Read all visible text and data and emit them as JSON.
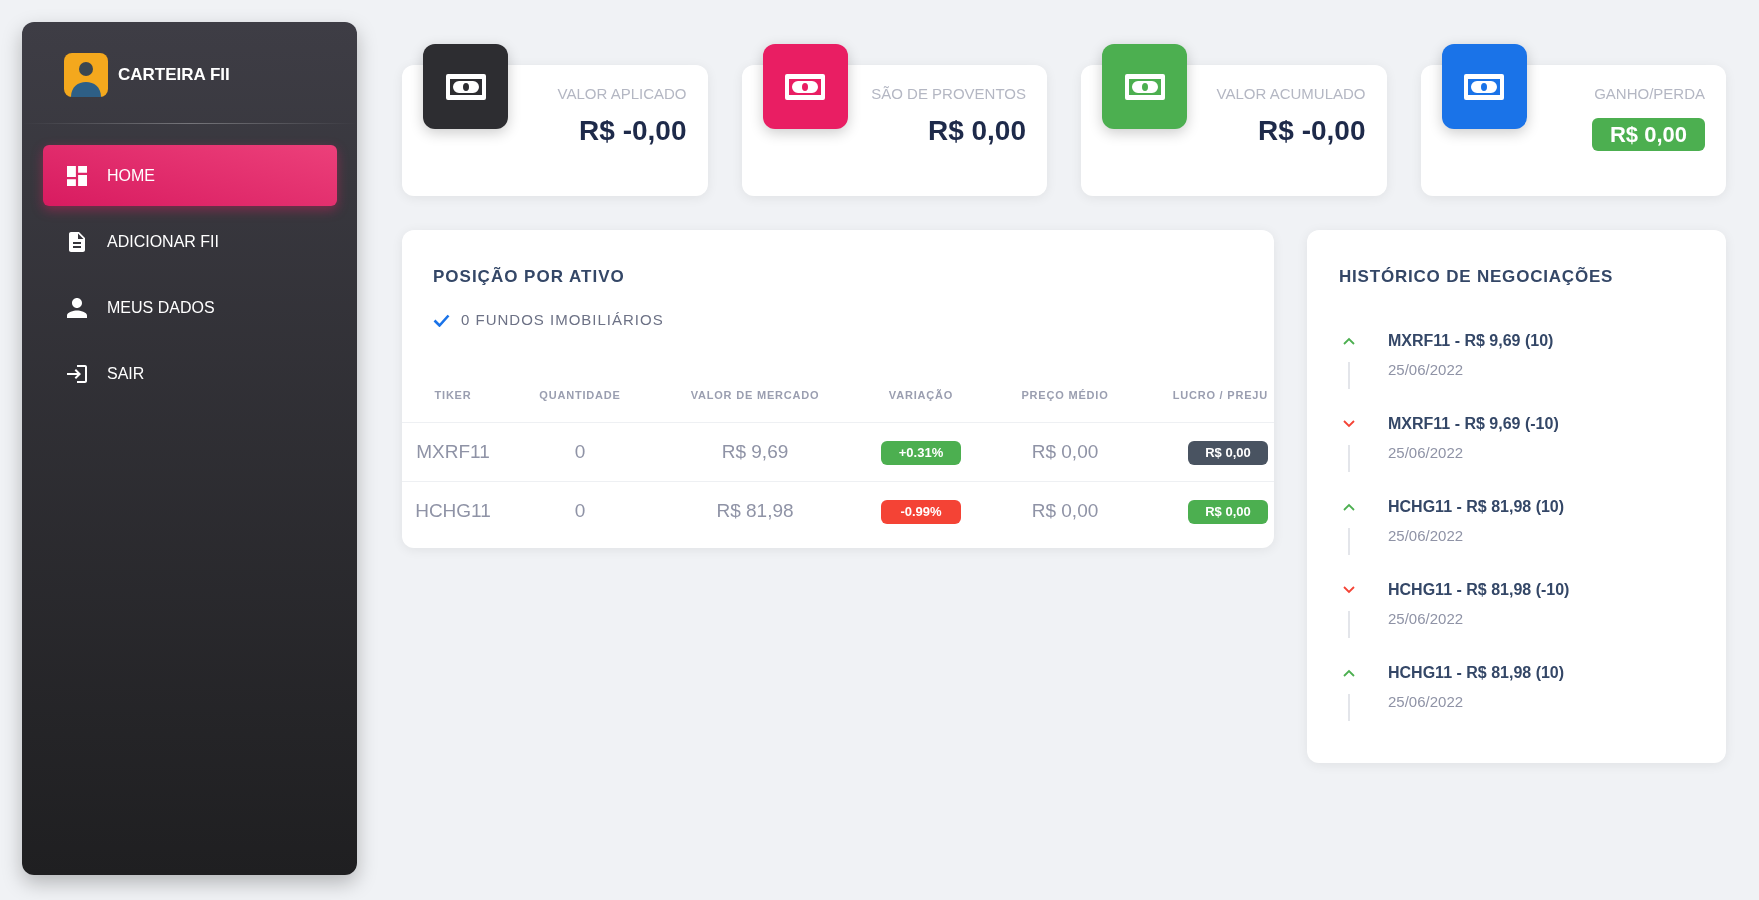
{
  "sidebar": {
    "brand": "CARTEIRA FII",
    "items": [
      {
        "label": "HOME",
        "selected": true
      },
      {
        "label": "ADICIONAR FII",
        "selected": false
      },
      {
        "label": "MEUS DADOS",
        "selected": false
      },
      {
        "label": "SAIR",
        "selected": false
      }
    ]
  },
  "stats": [
    {
      "kind": "plain",
      "label": "VALOR APLICADO",
      "value": "R$ -0,00",
      "color": "#2d2d31"
    },
    {
      "kind": "plain",
      "label": "SÃO DE PROVENTOS",
      "value": "R$ 0,00",
      "color": "#e91e63"
    },
    {
      "kind": "plain",
      "label": "VALOR ACUMULADO",
      "value": "R$ -0,00",
      "color": "#4caf50"
    },
    {
      "kind": "badge",
      "label": "GANHO/PERDA",
      "badge": {
        "text": "R$ 0,00",
        "color": "#4caf50"
      },
      "color": "#1a73e8"
    }
  ],
  "positions": {
    "title": "POSIÇÃO POR ATIVO",
    "summary": "0 FUNDOS IMOBILIÁRIOS",
    "table": {
      "columns": [
        "TIKER",
        "QUANTIDADE",
        "VALOR DE MERCADO",
        "VARIAÇÃO",
        "PREÇO MÉDIO",
        "LUCRO / PREJU"
      ],
      "rows": [
        {
          "cells": [
            {
              "kind": "text",
              "text": "MXRF11"
            },
            {
              "kind": "text",
              "text": "0"
            },
            {
              "kind": "text",
              "text": "R$ 9,69"
            },
            {
              "kind": "badge",
              "text": "+0.31%",
              "color": "#4caf50"
            },
            {
              "kind": "text",
              "text": "R$ 0,00"
            },
            {
              "kind": "badge",
              "text": "R$ 0,00",
              "color": "#495361"
            }
          ]
        },
        {
          "cells": [
            {
              "kind": "text",
              "text": "HCHG11"
            },
            {
              "kind": "text",
              "text": "0"
            },
            {
              "kind": "text",
              "text": "R$ 81,98"
            },
            {
              "kind": "badge",
              "text": "-0.99%",
              "color": "#f44335"
            },
            {
              "kind": "text",
              "text": "R$ 0,00"
            },
            {
              "kind": "badge",
              "text": "R$ 0,00",
              "color": "#4caf50"
            }
          ]
        }
      ]
    }
  },
  "history": {
    "title": "HISTÓRICO DE NEGOCIAÇÕES",
    "items": [
      {
        "kind": "up",
        "title": "MXRF11 - R$ 9,69 (10)",
        "date": "25/06/2022"
      },
      {
        "kind": "down",
        "title": "MXRF11 - R$ 9,69 (-10)",
        "date": "25/06/2022"
      },
      {
        "kind": "up",
        "title": "HCHG11 - R$ 81,98 (10)",
        "date": "25/06/2022"
      },
      {
        "kind": "down",
        "title": "HCHG11 - R$ 81,98 (-10)",
        "date": "25/06/2022"
      },
      {
        "kind": "up",
        "title": "HCHG11 - R$ 81,98 (10)",
        "date": "25/06/2022"
      }
    ]
  }
}
